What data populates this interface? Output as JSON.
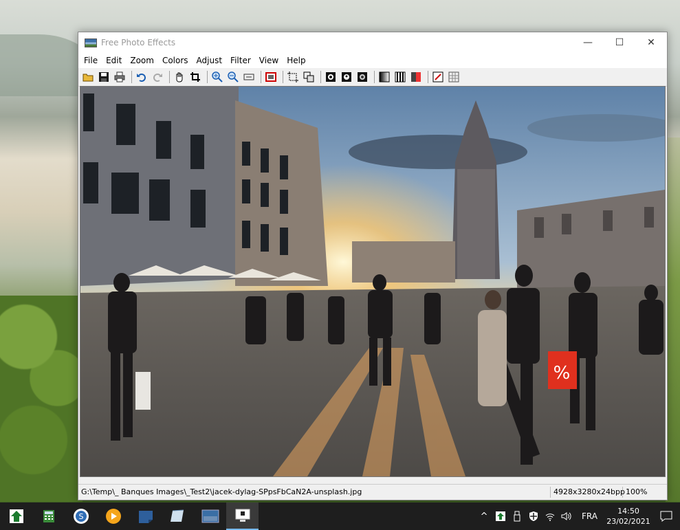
{
  "window": {
    "title": "Free Photo Effects",
    "buttons": {
      "minimize": "—",
      "maximize": "☐",
      "close": "✕"
    }
  },
  "menu": [
    "File",
    "Edit",
    "Zoom",
    "Colors",
    "Adjust",
    "Filter",
    "View",
    "Help"
  ],
  "toolbar": {
    "groups": [
      [
        "open-icon",
        "save-icon",
        "print-icon"
      ],
      [
        "undo-icon",
        "redo-icon"
      ],
      [
        "hand-icon",
        "crop-icon"
      ],
      [
        "zoom-in-icon",
        "zoom-out-icon",
        "zoom-fit-icon"
      ],
      [
        "frame-icon"
      ],
      [
        "select-icon",
        "resize-icon"
      ],
      [
        "mask-1-icon",
        "mask-2-icon",
        "mask-3-icon"
      ],
      [
        "gradient-icon",
        "bars-icon",
        "color-balance-icon"
      ],
      [
        "effect-icon",
        "grid-icon"
      ]
    ]
  },
  "status": {
    "path": "G:\\Temp\\_ Banques Images\\_Test2\\jacek-dylag-SPpsFbCaN2A-unsplash.jpg",
    "dimensions": "4928x3280x24bpp",
    "zoom": "100%"
  },
  "taskbar": {
    "apps": [
      "app-home-icon",
      "app-calc-icon",
      "app-circle-icon",
      "app-media-icon",
      "app-note-icon",
      "app-book-icon",
      "app-photo-icon",
      "app-monitor-icon"
    ],
    "tray": {
      "lang": "FRA",
      "time": "14:50",
      "date": "23/02/2021"
    }
  },
  "image": {
    "sign_text": "%"
  }
}
